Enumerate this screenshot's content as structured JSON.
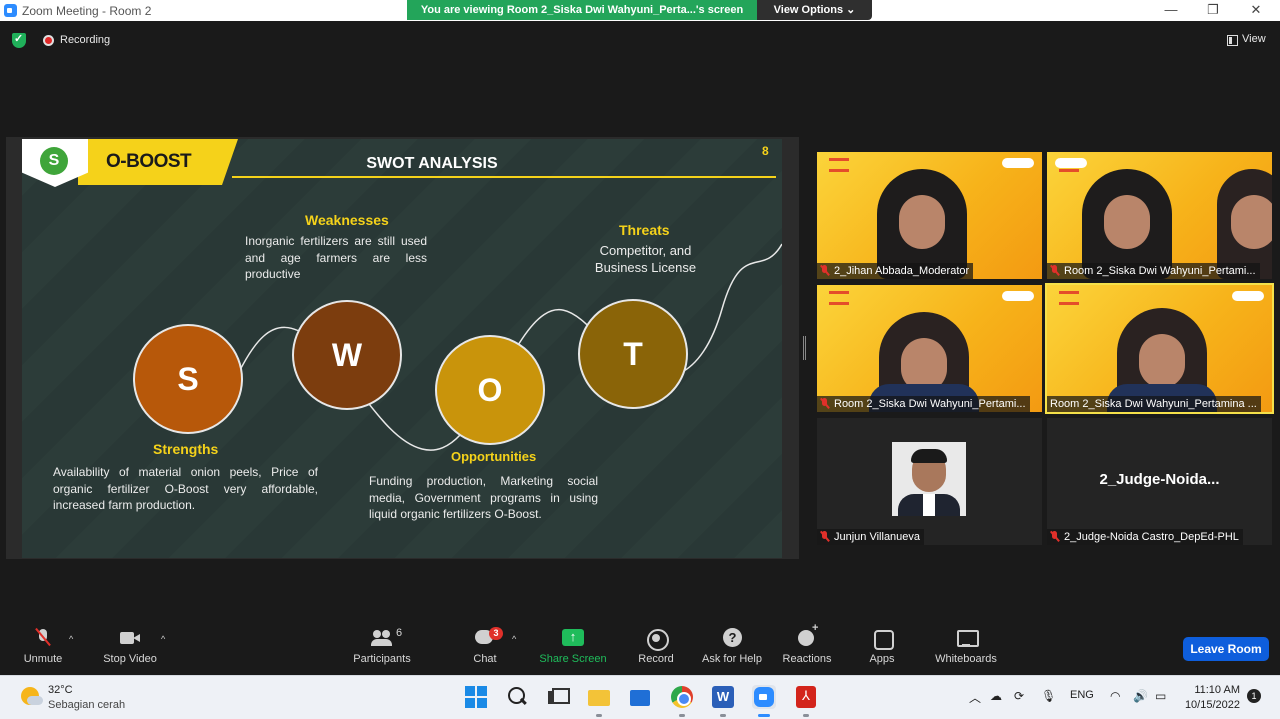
{
  "window": {
    "title": "Zoom Meeting - Room 2",
    "viewing_banner": "You are viewing Room 2_Siska Dwi Wahyuni_Perta...'s screen",
    "view_options": "View Options ⌄",
    "minimize": "—",
    "maximize": "❐",
    "close": "✕"
  },
  "status": {
    "recording": "Recording",
    "view": "View"
  },
  "slide": {
    "brand": "O-BOOST",
    "logo_letter": "S",
    "title": "SWOT ANALYSIS",
    "page_number": "8",
    "circles": {
      "s": "S",
      "w": "W",
      "o": "O",
      "t": "T"
    },
    "strengths": {
      "heading": "Strengths",
      "text": "Availability of material onion peels, Price of organic fertilizer O-Boost very affordable, increased farm production."
    },
    "weaknesses": {
      "heading": "Weaknesses",
      "text": "Inorganic fertilizers are still used and age farmers are less productive"
    },
    "opportunities": {
      "heading": "Opportunities",
      "text": "Funding production, Marketing social media, Government programs in using liquid organic fertilizers O-Boost."
    },
    "threats": {
      "heading": "Threats",
      "text": "Competitor, and Business License"
    }
  },
  "participants_tiles": [
    {
      "name": "2_Jihan Abbada_Moderator"
    },
    {
      "name": "Room 2_Siska Dwi Wahyuni_Pertami..."
    },
    {
      "name": "Room 2_Siska Dwi Wahyuni_Pertami..."
    },
    {
      "name": "Room 2_Siska Dwi Wahyuni_Pertamina ..."
    },
    {
      "name": "Junjun Villanueva"
    },
    {
      "name": "2_Judge-Noida Castro_DepEd-PHL",
      "display_name": "2_Judge-Noida..."
    }
  ],
  "toolbar": {
    "unmute": "Unmute",
    "stop_video": "Stop Video",
    "participants": "Participants",
    "participants_count": "6",
    "chat": "Chat",
    "chat_badge": "3",
    "share_screen": "Share Screen",
    "record": "Record",
    "ask_for_help": "Ask for Help",
    "reactions": "Reactions",
    "apps": "Apps",
    "whiteboards": "Whiteboards",
    "leave_room": "Leave Room",
    "caret": "^"
  },
  "taskbar": {
    "temperature": "32°C",
    "condition": "Sebagian cerah",
    "language": "ENG",
    "time": "11:10 AM",
    "date": "10/15/2022",
    "notifications": "1"
  },
  "colors": {
    "share_green": "#1fbc5b",
    "leave_blue": "#0e5edc",
    "slide_yellow": "#f5d21a",
    "circle_s": "#b7580a",
    "circle_w": "#7c3d0e",
    "circle_o": "#c9940b",
    "circle_t": "#8a6408"
  }
}
